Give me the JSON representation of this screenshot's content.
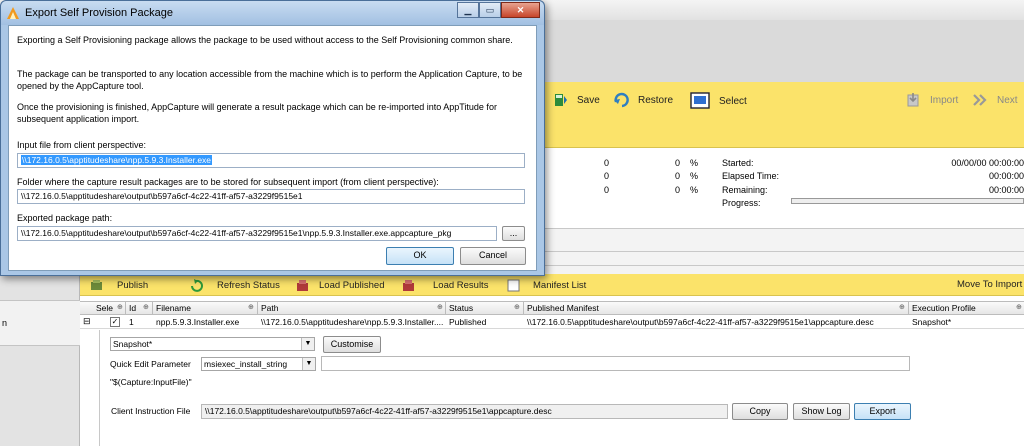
{
  "dialog": {
    "title": "Export Self Provision Package",
    "caption_buttons": {
      "minimize": "▁",
      "maximize": "▭",
      "close": "✕"
    },
    "paragraphs": [
      "Exporting a Self Provisioning package allows the package to be used without access to the Self Provisioning common share.",
      "The package can be transported to any location accessible from the machine which is to perform the Application Capture, to be opened by the AppCapture tool.",
      "Once the provisioning is finished, AppCapture will generate a result package which can be re-imported into AppTitude for subsequent application import."
    ],
    "input_file_label": "Input file from client perspective:",
    "input_file_value": "\\\\172.16.0.5\\apptitudeshare\\npp.5.9.3.Installer.exe",
    "folder_label": "Folder where the capture result packages are to be stored for subsequent import (from client perspective):",
    "folder_value": "\\\\172.16.0.5\\apptitudeshare\\output\\b597a6cf-4c22-41ff-af57-a3229f9515e1",
    "exported_label": "Exported package path:",
    "exported_value": "\\\\172.16.0.5\\apptitudeshare\\output\\b597a6cf-4c22-41ff-af57-a3229f9515e1\\npp.5.9.3.Installer.exe.appcapture_pkg",
    "browse_label": "...",
    "ok_label": "OK",
    "cancel_label": "Cancel"
  },
  "toolbar": {
    "save": "Save",
    "restore": "Restore",
    "select": "Select",
    "import": "Import",
    "next": "Next"
  },
  "stats": {
    "rows": [
      {
        "count": "0",
        "value": "0",
        "unit": "%",
        "label": "Started:",
        "time": "00/00/00 00:00:00"
      },
      {
        "count": "0",
        "value": "0",
        "unit": "%",
        "label": "Elapsed Time:",
        "time": "00:00:00"
      },
      {
        "count": "0",
        "value": "0",
        "unit": "%",
        "label": "Remaining:",
        "time": "00:00:00"
      }
    ],
    "progress_label": "Progress:",
    "progress": 0
  },
  "left_panel": {
    "text": "n"
  },
  "toolbar2": {
    "publish": "Publish",
    "refresh": "Refresh Status",
    "load_published": "Load Published",
    "load_results": "Load Results",
    "manifest": "Manifest List",
    "move": "Move To Import"
  },
  "grid": {
    "headers": [
      "Sele",
      "Id",
      "Filename",
      "Path",
      "Status",
      "Published Manifest",
      "Execution Profile"
    ],
    "row": {
      "expander": "⊟",
      "checkbox": "✓",
      "id": "1",
      "filename": "npp.5.9.3.Installer.exe",
      "path": "\\\\172.16.0.5\\apptitudeshare\\npp.5.9.3.Installer....",
      "status": "Published",
      "manifest": "\\\\172.16.0.5\\apptitudeshare\\output\\b597a6cf-4c22-41ff-af57-a3229f9515e1\\appcapture.desc",
      "profile": "Snapshot*"
    }
  },
  "detail": {
    "profile_combo": "Snapshot*",
    "customise": "Customise",
    "quick_edit_label": "Quick  Edit Parameter",
    "param_combo": "msiexec_install_string",
    "param_value": "",
    "capture_input": "\"$(Capture:InputFile)\"",
    "client_instruction_label": "Client Instruction File",
    "client_instruction_value": "\\\\172.16.0.5\\apptitudeshare\\output\\b597a6cf-4c22-41ff-af57-a3229f9515e1\\appcapture.desc",
    "copy": "Copy",
    "show_log": "Show Log",
    "export": "Export"
  },
  "colors": {
    "toolbar_yellow": "#fbe36a",
    "dialog_frame": "#aac7e6",
    "selection": "#3399ff"
  }
}
